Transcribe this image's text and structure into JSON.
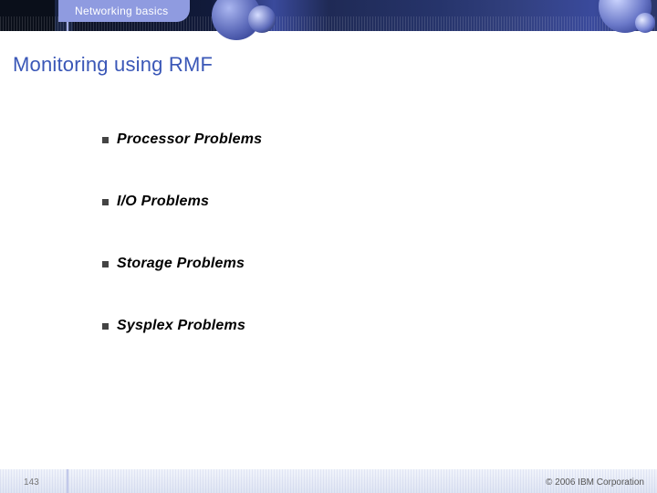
{
  "header": {
    "section_label": "Networking basics"
  },
  "title": "Monitoring using RMF",
  "bullets": [
    "Processor Problems",
    "I/O Problems",
    "Storage Problems",
    "Sysplex Problems"
  ],
  "footer": {
    "page_number": "143",
    "copyright": "© 2006 IBM Corporation"
  }
}
